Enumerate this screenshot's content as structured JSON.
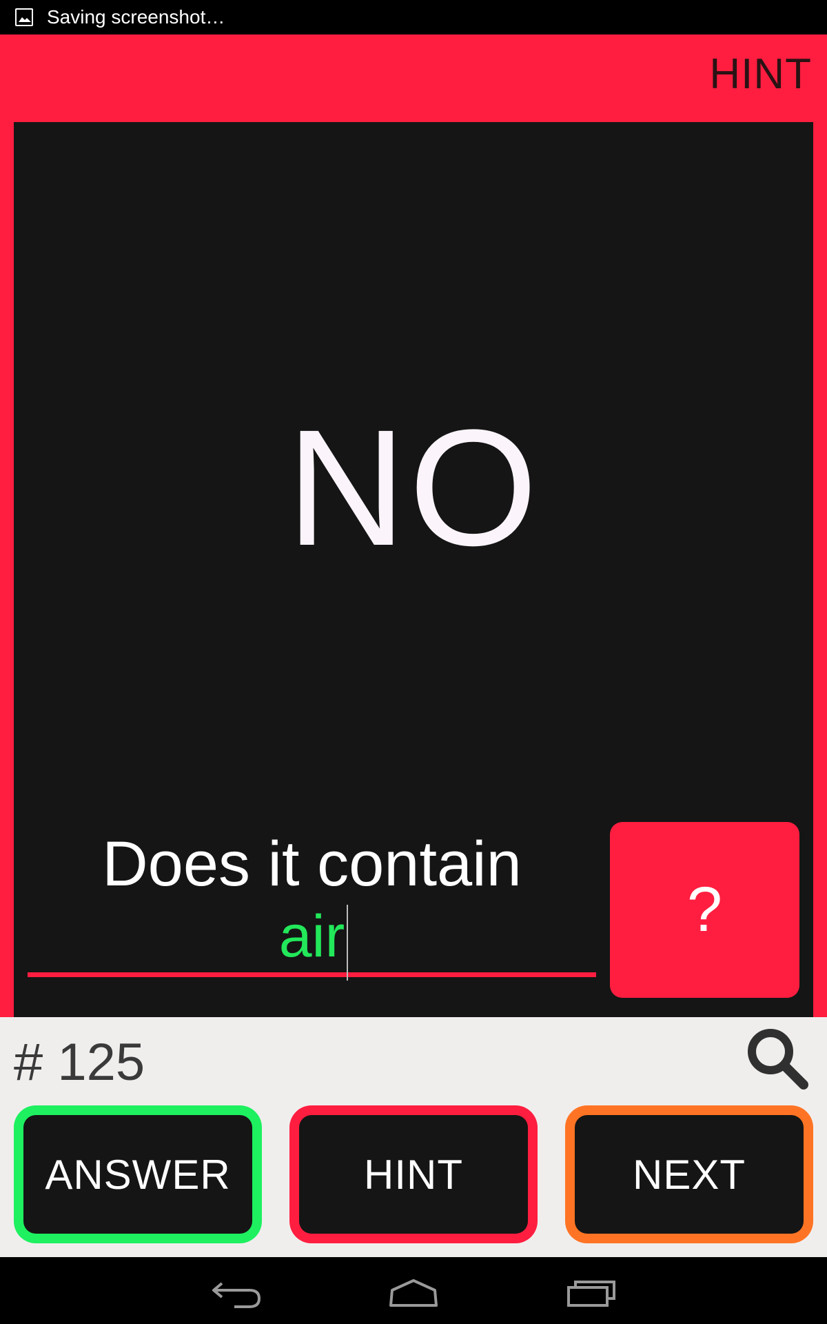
{
  "status_bar": {
    "notification_icon": "image-icon",
    "text": "Saving screenshot…"
  },
  "action_bar": {
    "hint_label": "HINT"
  },
  "card": {
    "answer": "NO",
    "question": "Does it contain",
    "input_value": "air",
    "ask_button_label": "?"
  },
  "bottom": {
    "counter": "# 125",
    "search_icon": "search-icon",
    "buttons": {
      "answer": "ANSWER",
      "hint": "HINT",
      "next": "NEXT"
    }
  },
  "colors": {
    "accent_red": "#ff1e40",
    "answer_green": "#1ef060",
    "next_orange": "#ff7424",
    "card_dark": "#151515",
    "panel_light": "#f0eeed"
  },
  "nav_bar": {
    "back_icon": "back-icon",
    "home_icon": "home-icon",
    "recents_icon": "recents-icon"
  }
}
